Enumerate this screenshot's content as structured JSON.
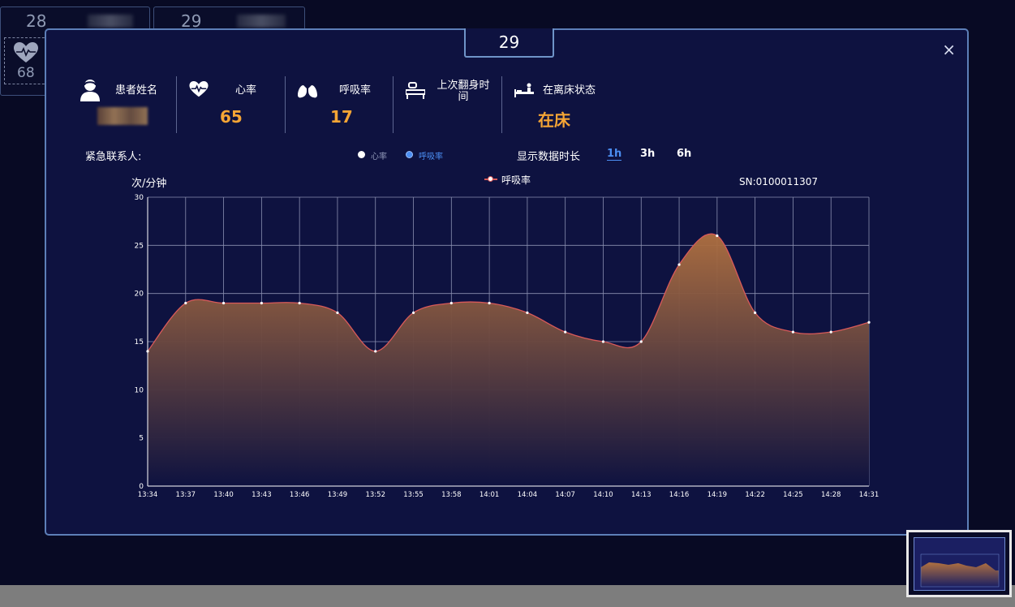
{
  "background": {
    "card1": {
      "number": "28",
      "heart_value": "68"
    },
    "card2": {
      "number": "29"
    }
  },
  "modal": {
    "title": "29",
    "close_label": "×",
    "patient_name_label": "患者姓名",
    "heart_rate_label": "心率",
    "heart_rate_value": "65",
    "resp_rate_label": "呼吸率",
    "resp_rate_value": "17",
    "last_turn_label": "上次翻身时间",
    "bed_status_label": "在离床状态",
    "bed_status_value": "在床",
    "emergency_contact_label": "紧急联系人:",
    "toggle_heart": "心率",
    "toggle_resp": "呼吸率",
    "duration_label": "显示数据时长",
    "durations": [
      "1h",
      "3h",
      "6h"
    ],
    "active_duration": "1h",
    "sn": "SN:0100011307",
    "icons": [
      "user-icon",
      "heart-icon",
      "lungs-icon",
      "turn-over-icon",
      "bed-icon"
    ]
  },
  "chart_data": {
    "type": "area",
    "ylabel": "次/分钟",
    "legend": "呼吸率",
    "ylim": [
      0,
      30
    ],
    "yticks": [
      0,
      5,
      10,
      15,
      20,
      25,
      30
    ],
    "x": [
      "13:34",
      "13:37",
      "13:40",
      "13:43",
      "13:46",
      "13:49",
      "13:52",
      "13:55",
      "13:58",
      "14:01",
      "14:04",
      "14:07",
      "14:10",
      "14:13",
      "14:16",
      "14:19",
      "14:22",
      "14:25",
      "14:28",
      "14:31"
    ],
    "series": [
      {
        "name": "呼吸率",
        "values": [
          14,
          19,
          19,
          19,
          19,
          18,
          14,
          18,
          19,
          19,
          18,
          16,
          15,
          15,
          23,
          26,
          18,
          16,
          16,
          17
        ]
      }
    ],
    "grid": true,
    "colors": {
      "line": "#d95a5a",
      "fill_top": "#b07040",
      "fill_bottom": "#0e1240",
      "grid": "#8a8fb0"
    }
  }
}
